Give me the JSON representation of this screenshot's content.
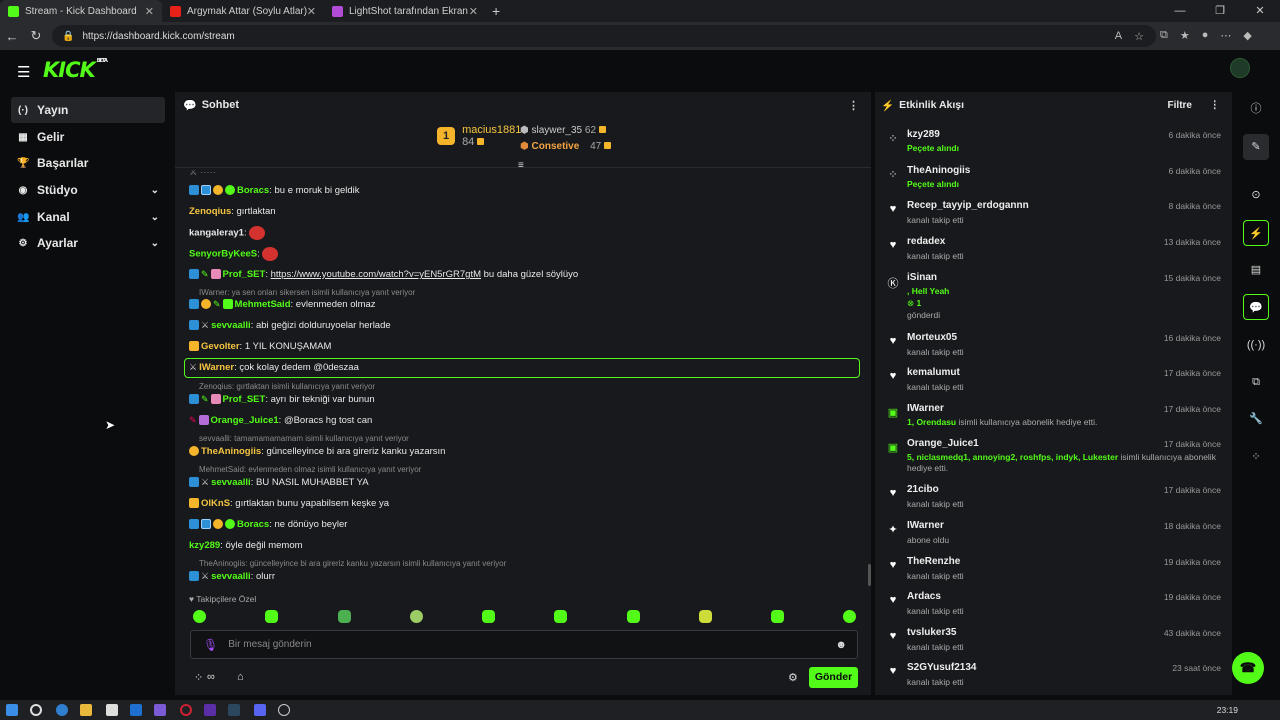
{
  "browser": {
    "tabs": [
      {
        "label": "Stream - Kick Dashboard",
        "fav": "#53fc18"
      },
      {
        "label": "Argymak Attar (Soylu Atlar) Altay",
        "fav": "#e62117"
      },
      {
        "label": "LightShot tarafından Ekran Görün",
        "fav": "#b24bd6"
      }
    ],
    "url": "https://dashboard.kick.com/stream",
    "new_tab": "+"
  },
  "app": {
    "logo": "KICK",
    "beta": "BETA"
  },
  "sidebar": {
    "items": [
      {
        "label": "Yayın",
        "icon": "broadcast-icon"
      },
      {
        "label": "Gelir",
        "icon": "revenue-icon"
      },
      {
        "label": "Başarılar",
        "icon": "trophy-icon"
      },
      {
        "label": "Stüdyo",
        "icon": "studio-icon"
      },
      {
        "label": "Kanal",
        "icon": "users-icon"
      },
      {
        "label": "Ayarlar",
        "icon": "gear-icon"
      }
    ]
  },
  "chat": {
    "title": "Sohbet",
    "leaderboard": {
      "first": {
        "rank": "1",
        "name": "macius1881",
        "points": "84"
      },
      "second": {
        "name": "slaywer_35",
        "points": "62"
      },
      "third": {
        "name": "Consetive",
        "points": "47"
      }
    },
    "messages": [
      {
        "user": "Boracs",
        "color": "#53fc18",
        "text": ": bu e moruk bi geldik"
      },
      {
        "user": "Zenoqius",
        "color": "#f5c542",
        "text": ": gırtlaktan"
      },
      {
        "user": "kangaleray1",
        "color": "#e8e8e8",
        "text": ":"
      },
      {
        "user": "SenyorByKeeS",
        "color": "#53fc18",
        "text": ":"
      },
      {
        "user": "Prof_SET",
        "color": "#53fc18",
        "link": "https://www.youtube.com/watch?v=yEN5rGR7gtM",
        "text": " bu daha güzel söylüyo"
      },
      {
        "user": "MehmetSaid",
        "color": "#53fc18",
        "text": ": evlenmeden olmaz"
      },
      {
        "user": "sevvaalli",
        "color": "#53fc18",
        "text": ": abi geğizi dolduruyoelar herlade"
      },
      {
        "user": "Gevolter",
        "color": "#f5c542",
        "text": ": 1 YIL KONUŞAMAM"
      },
      {
        "user": "IWarner",
        "color": "#f5c542",
        "text": ": çok kolay dedem @0deszaa"
      },
      {
        "user": "Prof_SET",
        "color": "#53fc18",
        "text": ": ayrı bir tekniği var bunun"
      },
      {
        "user": "Orange_Juice1",
        "color": "#53fc18",
        "text": ": @Boracs hg tost can"
      },
      {
        "user": "TheAninogiis",
        "color": "#f5c542",
        "text": ": güncelleyince bi ara gireriz kanku yazarsın"
      },
      {
        "user": "sevvaalli",
        "color": "#53fc18",
        "text": ": BU NASIL MUHABBET YA"
      },
      {
        "user": "OlKnS",
        "color": "#f5c542",
        "text": ": gırtlaktan bunu yapabilsem keşke ya"
      },
      {
        "user": "Boracs",
        "color": "#53fc18",
        "text": ": ne dönüyo beyler"
      },
      {
        "user": "kzy289",
        "color": "#53fc18",
        "text": ": öyle değil memom"
      },
      {
        "user": "sevvaalli",
        "color": "#53fc18",
        "text": ": olurr"
      }
    ],
    "replies": [
      "IWarner: ya sen onları sikersen isimli kullanıcıya yanıt veriyor",
      "Zenoqius: gırtlaktan isimli kullanıcıya yanıt veriyor",
      "sevvaalli: tamamamamamam isimli kullanıcıya yanıt veriyor",
      "MehmetSaid: evlenmeden olmaz isimli kullanıcıya yanıt veriyor",
      "TheAninogiis: güncelleyince bi ara gireriz kanku yazarsın isimli kullanıcıya yanıt veriyor"
    ],
    "followers_label": "Takipçilere Özel",
    "input_placeholder": "Bir mesaj gönderin",
    "send_label": "Gönder"
  },
  "activity": {
    "title": "Etkinlik Akışı",
    "filter": "Filtre",
    "events": [
      {
        "name": "kzy289",
        "time": "6 dakika önce",
        "sub": "Peçete alındı",
        "icon": "gift-icon",
        "green": true
      },
      {
        "name": "TheAninogiis",
        "time": "6 dakika önce",
        "sub": "Peçete alındı",
        "icon": "gift-icon",
        "green": true
      },
      {
        "name": "Recep_tayyip_erdogannn",
        "time": "8 dakika önce",
        "sub": "kanalı takip etti",
        "icon": "heart-icon"
      },
      {
        "name": "redadex",
        "time": "13 dakika önce",
        "sub": "kanalı takip etti",
        "icon": "heart-icon"
      },
      {
        "name": "iSinan",
        "time": "15 dakika önce",
        "sub": ", Hell Yeah",
        "sub2": "1",
        "sub3": "gönderdi",
        "icon": "kick-coin-icon"
      },
      {
        "name": "Morteux05",
        "time": "16 dakika önce",
        "sub": "kanalı takip etti",
        "icon": "heart-icon"
      },
      {
        "name": "kemalumut",
        "time": "17 dakika önce",
        "sub": "kanalı takip etti",
        "icon": "heart-icon"
      },
      {
        "name": "IWarner",
        "time": "17 dakika önce",
        "subg": "1, Orendasu",
        "sub": " isimli kullanıcıya abonelik hediye etti.",
        "icon": "gift-sub-icon"
      },
      {
        "name": "Orange_Juice1",
        "time": "17 dakika önce",
        "subg": "5, niclasmedq1, annoying2, roshfps, indyk, Lukester",
        "sub": " isimli kullanıcıya abonelik",
        "sub3": "hediye etti.",
        "icon": "gift-sub-icon"
      },
      {
        "name": "21cibo",
        "time": "17 dakika önce",
        "sub": "kanalı takip etti",
        "icon": "heart-icon"
      },
      {
        "name": "IWarner",
        "time": "18 dakika önce",
        "sub": "abone oldu",
        "icon": "star-icon"
      },
      {
        "name": "TheRenzhe",
        "time": "19 dakika önce",
        "sub": "kanalı takip etti",
        "icon": "heart-icon"
      },
      {
        "name": "Ardacs",
        "time": "19 dakika önce",
        "sub": "kanalı takip etti",
        "icon": "heart-icon"
      },
      {
        "name": "tvsluker35",
        "time": "43 dakika önce",
        "sub": "kanalı takip etti",
        "icon": "heart-icon"
      },
      {
        "name": "S2GYusuf2134",
        "time": "23 saat önce",
        "sub": "kanalı takip etti",
        "icon": "heart-icon"
      }
    ]
  },
  "taskbar": {
    "time": "23:19"
  },
  "colors": {
    "accent": "#53fc18",
    "panel": "#18191c",
    "bg": "#0b0c0d"
  }
}
